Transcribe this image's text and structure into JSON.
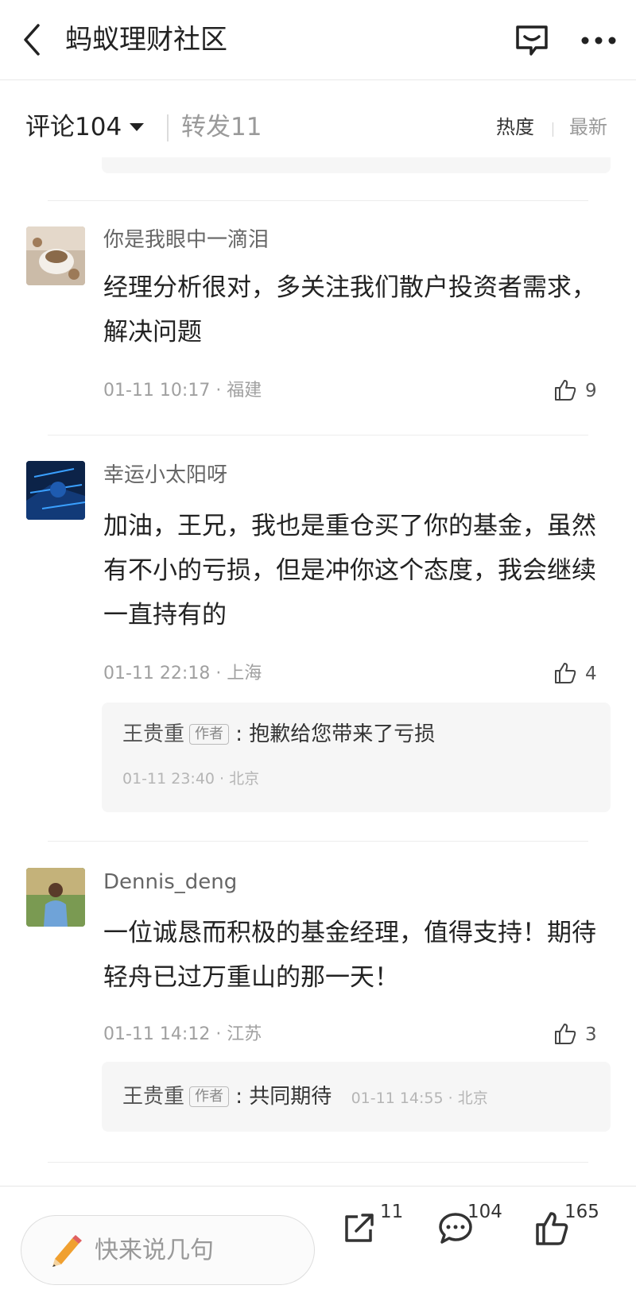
{
  "header": {
    "title": "蚂蚁理财社区"
  },
  "tabs": {
    "comments_label": "评论104",
    "reposts_label": "转发11",
    "sort_hot": "热度",
    "sort_new": "最新"
  },
  "comments": [
    {
      "username": "你是我眼中一滴泪",
      "content": "经理分析很对，多关注我们散户投资者需求，解决问题",
      "time": "01-11 10:17 · 福建",
      "likes": "9"
    },
    {
      "username": "幸运小太阳呀",
      "content": "加油，王兄，我也是重仓买了你的基金，虽然有不小的亏损，但是冲你这个态度，我会继续一直持有的",
      "time": "01-11 22:18 · 上海",
      "likes": "4",
      "reply": {
        "author": "王贵重",
        "badge": "作者",
        "text": ": 抱歉给您带来了亏损",
        "time": "01-11 23:40 · 北京"
      }
    },
    {
      "username": "Dennis_deng",
      "content": "一位诚恳而积极的基金经理，值得支持！期待轻舟已过万重山的那一天！",
      "time": "01-11 14:12 · 江苏",
      "likes": "3",
      "reply": {
        "author": "王贵重",
        "badge": "作者",
        "text": ": 共同期待",
        "time": "01-11 14:55 · 北京"
      }
    }
  ],
  "bottom_bar": {
    "input_placeholder": "快来说几句",
    "share_count": "11",
    "comment_count": "104",
    "like_count": "165"
  },
  "icons": {
    "back": "back-arrow-icon",
    "chat": "chat-service-icon",
    "more": "more-dots-icon",
    "like": "thumbs-up-icon",
    "pencil": "pencil-icon",
    "share": "share-icon",
    "comment": "comment-bubble-icon"
  },
  "colors": {
    "text_primary": "#222222",
    "text_secondary": "#666666",
    "text_muted": "#a0a0a0",
    "reply_bg": "#f6f6f6",
    "pencil_orange": "#f0a030"
  }
}
